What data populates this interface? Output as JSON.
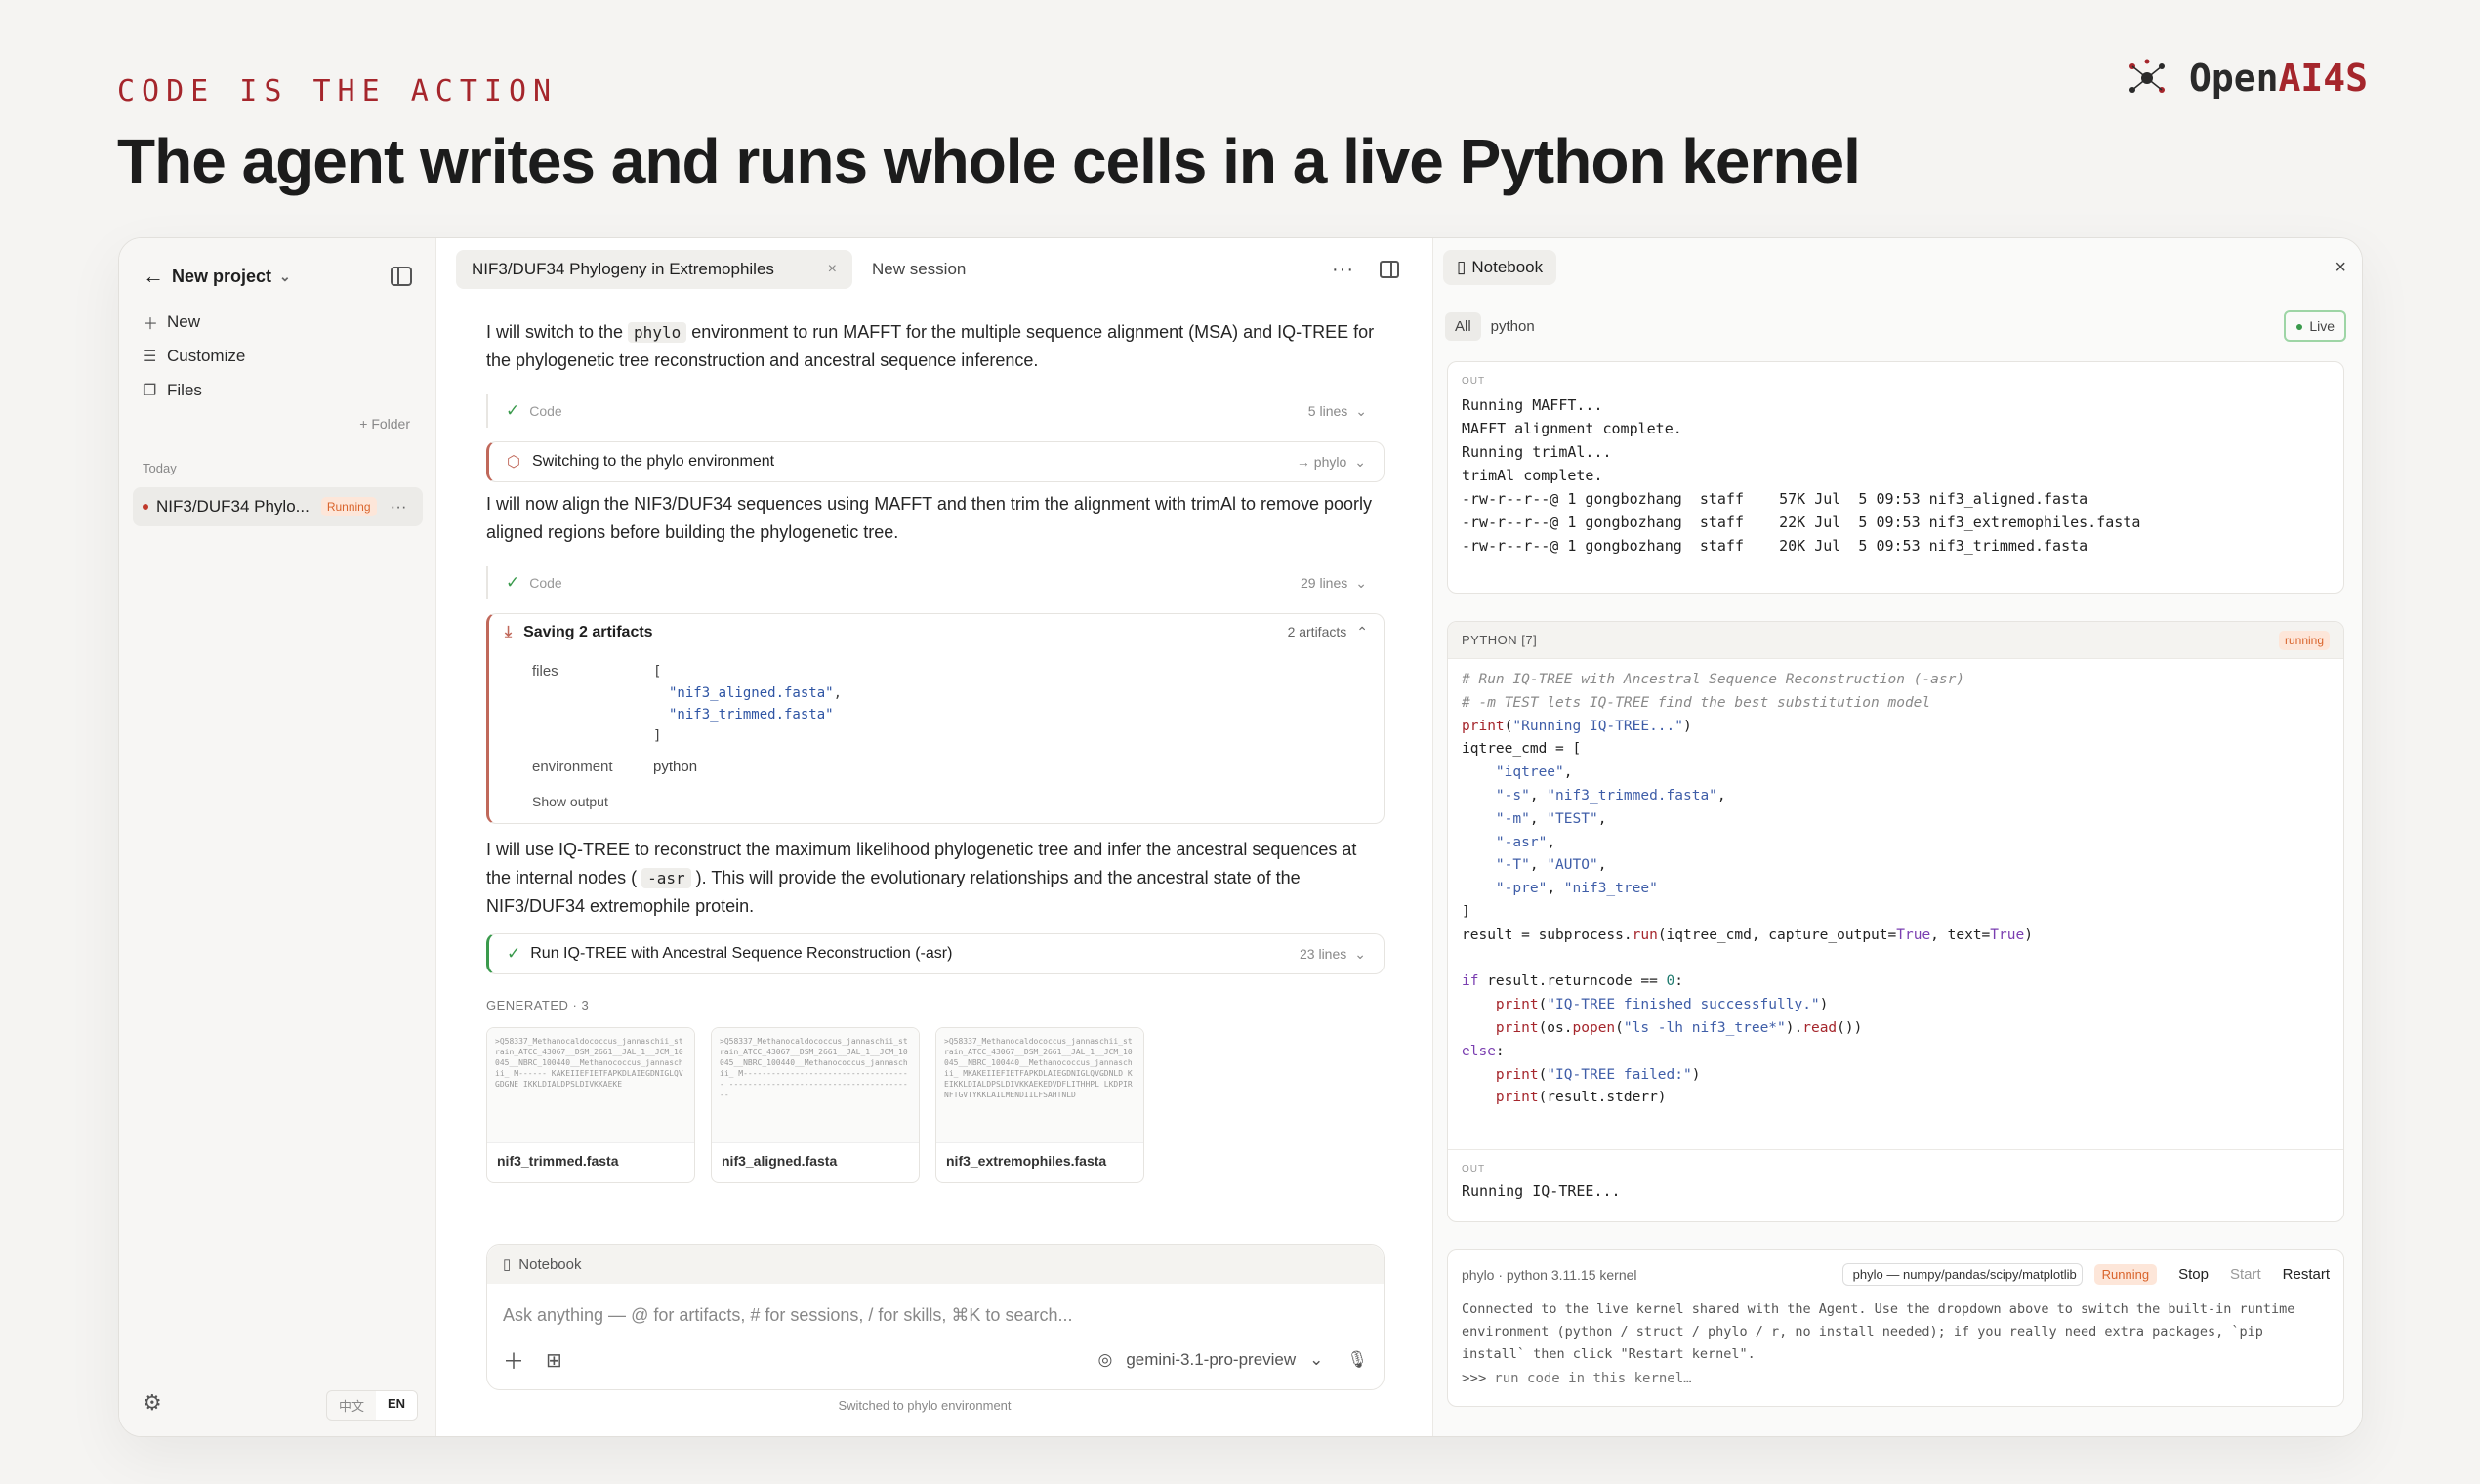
{
  "header": {
    "kicker": "CODE IS THE ACTION",
    "title": "The agent writes and runs whole cells in a live Python kernel",
    "brand_open": "Open",
    "brand_ai": "AI4S"
  },
  "colors": {
    "accent": "#a5262c",
    "running_badge": "#d9642c",
    "live_green": "#3a9a4c"
  },
  "sidebar": {
    "project": "New project",
    "items": [
      {
        "label": "New",
        "icon": "plus-icon"
      },
      {
        "label": "Customize",
        "icon": "sliders-icon"
      },
      {
        "label": "Files",
        "icon": "files-icon"
      }
    ],
    "folder": "+ Folder",
    "section": "Today",
    "session": {
      "title": "NIF3/DUF34 Phylo...",
      "status": "Running"
    },
    "lang": [
      "中文",
      "EN"
    ]
  },
  "chat": {
    "tab_active": "NIF3/DUF34 Phylogeny in Extremophiles",
    "tab_new": "New session",
    "p1_a": "I will switch to the ",
    "p1_code": "phylo",
    "p1_b": " environment to run MAFFT for the multiple sequence alignment (MSA) and IQ-TREE for the phylogenetic tree reconstruction and ancestral sequence inference.",
    "code1": {
      "label": "Code",
      "lines": "5 lines"
    },
    "switch": {
      "label": "Switching to the phylo environment",
      "target": "→ phylo"
    },
    "p2": "I will now align the NIF3/DUF34 sequences using MAFFT and then trim the alignment with trimAl to remove poorly aligned regions before building the phylogenetic tree.",
    "code2": {
      "label": "Code",
      "lines": "29 lines"
    },
    "artifacts": {
      "title": "Saving 2 artifacts",
      "count": "2 artifacts",
      "files_key": "files",
      "open": "[",
      "f1": "\"nif3_aligned.fasta\"",
      "comma1": ",",
      "f2": "\"nif3_trimmed.fasta\"",
      "close": "]",
      "env_key": "environment",
      "env_val": "python",
      "show": "Show output"
    },
    "p3_a": "I will use IQ-TREE to reconstruct the maximum likelihood phylogenetic tree and infer the ancestral sequences at the internal nodes ( ",
    "p3_code": "-asr",
    "p3_b": " ). This will provide the evolutionary relationships and the ancestral state of the NIF3/DUF34 extremophile protein.",
    "run_row": {
      "label": "Run IQ-TREE with Ancestral Sequence Reconstruction (-asr)",
      "lines": "23 lines"
    },
    "generated": "GENERATED · 3",
    "cards": [
      {
        "name": "nif3_trimmed.fasta",
        "preview": ">Q58337_Methanocaldococcus_jannaschii_strain_ATCC_43067__DSM_2661__JAL_1__JCM_10045__NBRC_100440__Methanococcus_jannaschii_ M------ KAKEIIEFIETFAPKDLAIEGDNIGLQVGDGNE IKKLDIALDPSLDIVKKAEKE"
      },
      {
        "name": "nif3_aligned.fasta",
        "preview": ">Q58337_Methanocaldococcus_jannaschii_strain_ATCC_43067__DSM_2661__JAL_1__JCM_10045__NBRC_100440__Methanococcus_jannaschii_ M------------------------------------ ----------------------------------------"
      },
      {
        "name": "nif3_extremophiles.fasta",
        "preview": ">Q58337_Methanocaldococcus_jannaschii_strain_ATCC_43067__DSM_2661__JAL_1__JCM_10045__NBRC_100440__Methanococcus_jannaschii_ MKAKEIIEFIETFAPKDLAIEGDNIGLQVGDNLD KEIKKLDIALDPSLDIVKKAEKEDVDFLITHHPL LKDPIRNFTGVTYKKLAILMENDIILFSAHTNLD"
      }
    ],
    "composer": {
      "tab": "Notebook",
      "placeholder": "Ask anything — @ for artifacts, # for sessions, / for skills, ⌘K to search...",
      "model": "gemini-3.1-pro-preview"
    },
    "footer": "Switched to phylo environment"
  },
  "notebook": {
    "title": "Notebook",
    "filters": [
      "All",
      "python"
    ],
    "live": "Live",
    "out_label": "OUT",
    "out1": "Running MAFFT...\nMAFFT alignment complete.\nRunning trimAl...\ntrimAl complete.\n-rw-r--r--@ 1 gongbozhang  staff    57K Jul  5 09:53 nif3_aligned.fasta\n-rw-r--r--@ 1 gongbozhang  staff    22K Jul  5 09:53 nif3_extremophiles.fasta\n-rw-r--r--@ 1 gongbozhang  staff    20K Jul  5 09:53 nif3_trimmed.fasta",
    "cell_label": "PYTHON [7]",
    "cell_status": "running",
    "out2": "Running IQ-TREE...",
    "kernel": {
      "info": "phylo · python 3.11.15 kernel",
      "select": "phylo — numpy/pandas/scipy/matplotlib",
      "status": "Running",
      "stop": "Stop",
      "start": "Start",
      "restart": "Restart",
      "msg": "Connected to the live kernel shared with the Agent. Use the dropdown above to switch the built-in runtime environment (python / struct / phylo / r, no install needed); if you really need extra packages, `pip install` then click \"Restart kernel\".",
      "prompt": ">>>",
      "placeholder": "run code in this kernel…"
    }
  }
}
